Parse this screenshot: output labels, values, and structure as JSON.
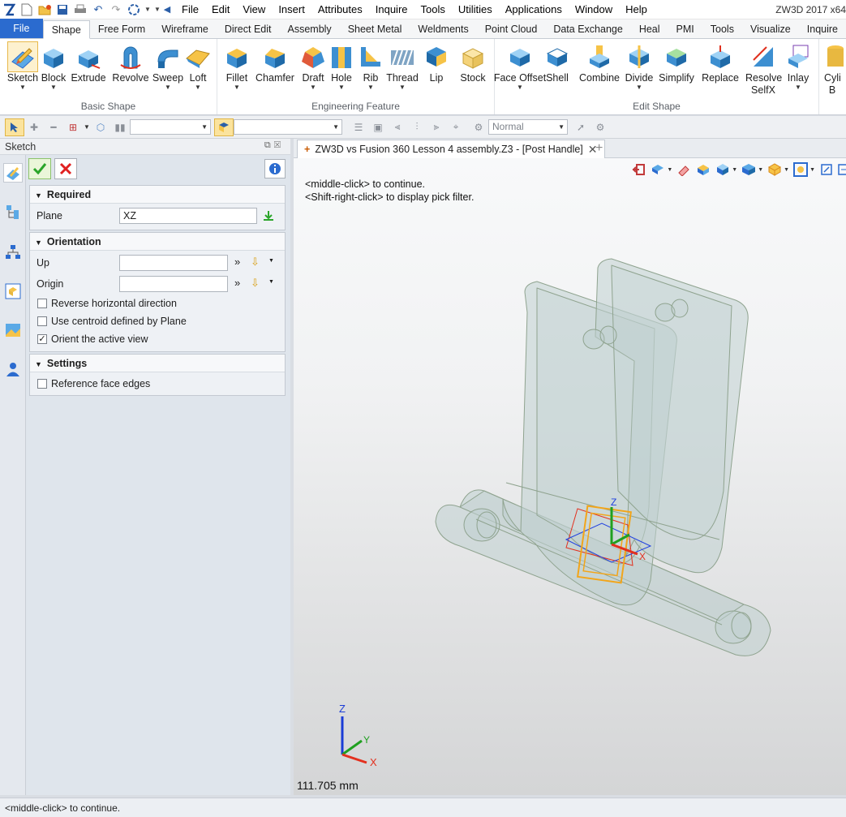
{
  "app": {
    "title": "ZW3D 2017 x64"
  },
  "quick_access": [
    "app-logo-icon",
    "new-file-icon",
    "open-file-icon",
    "save-icon",
    "print-icon",
    "undo-icon",
    "redo-icon",
    "repeat-icon"
  ],
  "menu": [
    "File",
    "Edit",
    "View",
    "Insert",
    "Attributes",
    "Inquire",
    "Tools",
    "Utilities",
    "Applications",
    "Window",
    "Help"
  ],
  "ribbon_tabs": [
    "File",
    "Shape",
    "Free Form",
    "Wireframe",
    "Direct Edit",
    "Assembly",
    "Sheet Metal",
    "Weldments",
    "Point Cloud",
    "Data Exchange",
    "Heal",
    "PMI",
    "Tools",
    "Visualize",
    "Inquire"
  ],
  "active_ribbon_tab": "Shape",
  "ribbon": {
    "basic_shape": {
      "label": "Basic Shape",
      "buttons": [
        "Sketch",
        "Block",
        "Extrude",
        "Revolve",
        "Sweep",
        "Loft"
      ]
    },
    "engineering_feature": {
      "label": "Engineering Feature",
      "buttons": [
        "Fillet",
        "Chamfer",
        "Draft",
        "Hole",
        "Rib",
        "Thread",
        "Lip",
        "Stock"
      ]
    },
    "edit_shape": {
      "label": "Edit Shape",
      "buttons": [
        "Face Offset",
        "Shell",
        "Combine",
        "Divide",
        "Simplify",
        "Replace",
        "Resolve SelfX",
        "Inlay"
      ]
    },
    "overflow_button": "Cyli B"
  },
  "toolbar": {
    "render_mode": "Normal"
  },
  "panel": {
    "title": "Sketch",
    "required": {
      "label": "Required",
      "plane_label": "Plane",
      "plane_value": "XZ"
    },
    "orientation": {
      "label": "Orientation",
      "up_label": "Up",
      "up_value": "",
      "origin_label": "Origin",
      "origin_value": "",
      "options": [
        {
          "label": "Reverse horizontal direction",
          "checked": false
        },
        {
          "label": "Use centroid defined by Plane",
          "checked": false
        },
        {
          "label": "Orient the active view",
          "checked": true
        }
      ]
    },
    "settings": {
      "label": "Settings",
      "options": [
        {
          "label": "Reference face edges",
          "checked": false
        }
      ]
    }
  },
  "document_tab": "ZW3D vs Fusion 360 Lesson 4 assembly.Z3 - [Post Handle]",
  "viewport": {
    "hint_1": "<middle-click> to continue.",
    "hint_2": "<Shift-right-click> to display pick filter.",
    "distance": "111.705 mm",
    "triad_labels": {
      "z": "Z",
      "y": "Y",
      "x": "X"
    }
  },
  "status_bar": "<middle-click> to continue.",
  "colors": {
    "file_tab": "#2b6bcf",
    "confirm": "#2aa52a",
    "cancel": "#e02020",
    "model": "#bfcfcf",
    "highlight": "#fbe39d"
  }
}
